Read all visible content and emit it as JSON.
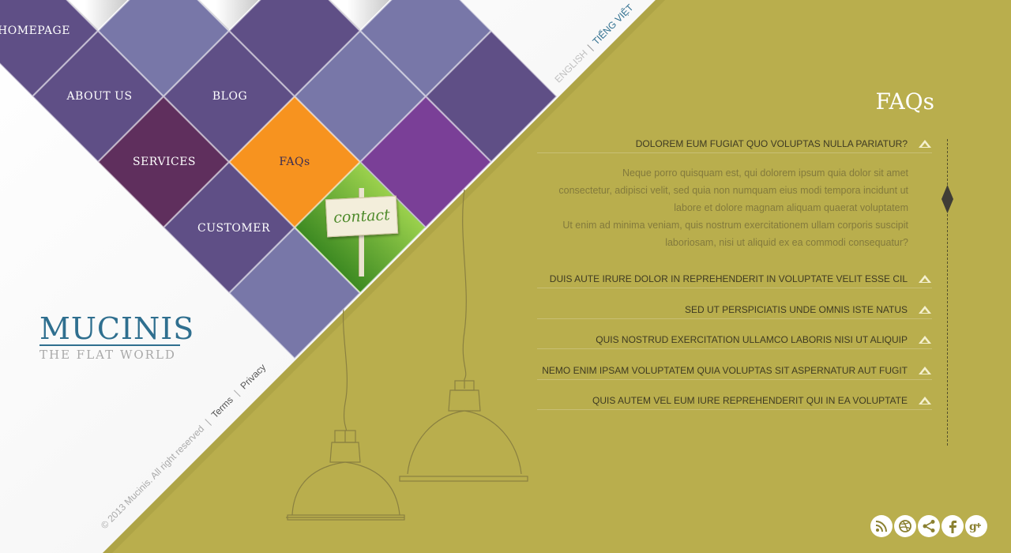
{
  "nav": {
    "homepage": "HOMEPAGE",
    "about": "ABOUT US",
    "blog": "BLOG",
    "services": "SERVICES",
    "faqs": "FAQs",
    "customer": "CUSTOMER",
    "contact_sign": "contact"
  },
  "lang": {
    "english": "ENGLISH",
    "separator": "|",
    "vietnamese": "TIẾNG VIỆT"
  },
  "logo": {
    "name": "MUCINIS",
    "tagline": "THE FLAT WORLD"
  },
  "footer": {
    "copyright": "© 2013 Mucinis. All right reserved",
    "separator": "|",
    "terms": "Terms",
    "privacy": "Privacy"
  },
  "faq": {
    "title": "FAQs",
    "items": [
      {
        "question": "DOLOREM EUM FUGIAT QUO VOLUPTAS NULLA PARIATUR?",
        "expanded": true
      },
      {
        "question": "DUIS AUTE IRURE DOLOR IN REPREHENDERIT IN VOLUPTATE VELIT ESSE CIL",
        "expanded": false
      },
      {
        "question": "SED UT PERSPICIATIS UNDE OMNIS ISTE NATUS",
        "expanded": false
      },
      {
        "question": "QUIS NOSTRUD EXERCITATION ULLAMCO LABORIS NISI UT ALIQUIP",
        "expanded": false
      },
      {
        "question": "NEMO ENIM IPSAM VOLUPTATEM QUIA VOLUPTAS SIT ASPERNATUR AUT FUGIT",
        "expanded": false
      },
      {
        "question": "QUIS AUTEM VEL EUM IURE REPREHENDERIT QUI IN EA VOLUPTATE",
        "expanded": false
      }
    ],
    "answer_lines": [
      "Neque porro quisquam est, qui dolorem ipsum quia dolor sit amet",
      "consectetur, adipisci velit, sed quia non numquam eius modi tempora incidunt ut",
      "labore et dolore magnam aliquam quaerat voluptatem",
      "Ut enim ad minima veniam, quis nostrum exercitationem ullam corporis suscipit",
      "laboriosam, nisi ut aliquid ex ea commodi consequatur?"
    ]
  },
  "social": [
    "rss-icon",
    "dribbble-icon",
    "share-icon",
    "facebook-icon",
    "google-plus-icon"
  ],
  "colors": {
    "background": "#b9ae4d",
    "tile_dark": "#5f4f86",
    "tile_light": "#7877a8",
    "tile_plum": "#5f2f5d",
    "tile_orange": "#f7931f",
    "tile_violet": "#7a3f97",
    "logo_blue": "#2f6f8f"
  }
}
